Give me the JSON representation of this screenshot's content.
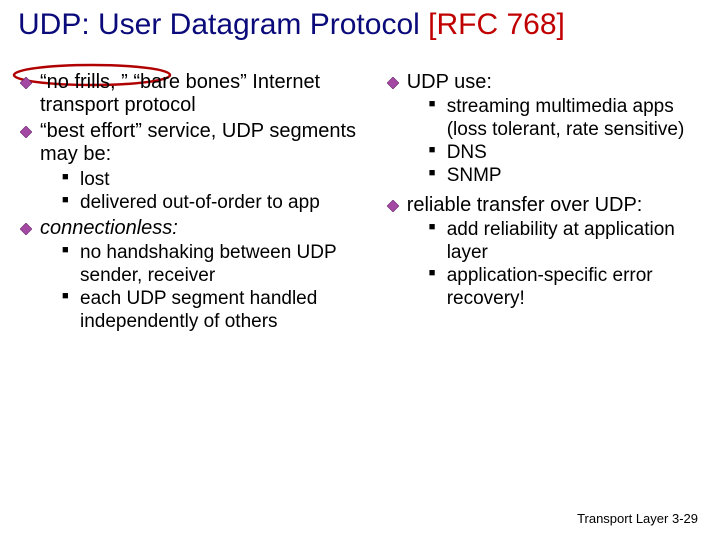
{
  "title_main": "UDP: User Datagram Protocol ",
  "title_rfc": "[RFC 768]",
  "left": {
    "b1": {
      "text": "“no frills, ” “bare bones” Internet transport protocol"
    },
    "b2": {
      "text": "“best effort” service, UDP segments may be:",
      "s1": "lost",
      "s2": "delivered out-of-order to app"
    },
    "b3": {
      "text": "connectionless:",
      "s1": "no handshaking between UDP sender, receiver",
      "s2": "each UDP segment handled independently of others"
    }
  },
  "right": {
    "b1": {
      "text": "UDP use:",
      "s1": "streaming multimedia apps (loss tolerant, rate sensitive)",
      "s2": "DNS",
      "s3": "SNMP"
    },
    "b2": {
      "text": "reliable transfer over UDP:",
      "s1": "add reliability at application layer",
      "s2": "application-specific error recovery!"
    }
  },
  "footer": {
    "label": "Transport Layer",
    "page": "3-29"
  }
}
